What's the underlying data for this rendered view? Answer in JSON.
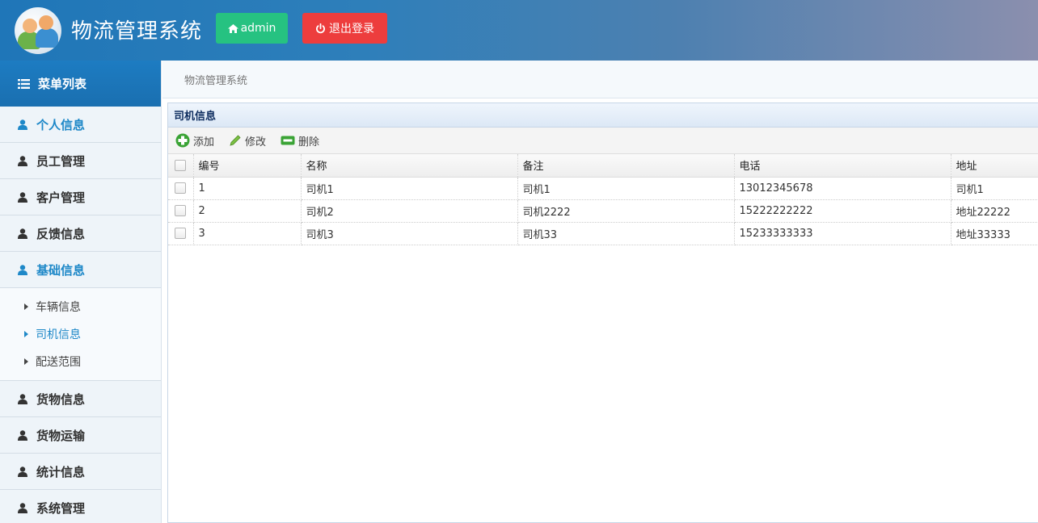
{
  "header": {
    "title": "物流管理系统",
    "user_button": "admin",
    "logout_button": "退出登录"
  },
  "sidebar": {
    "heading": "菜单列表",
    "items": [
      {
        "label": "个人信息",
        "active": true
      },
      {
        "label": "员工管理",
        "active": false
      },
      {
        "label": "客户管理",
        "active": false
      },
      {
        "label": "反馈信息",
        "active": false
      },
      {
        "label": "基础信息",
        "active": true
      },
      {
        "label": "货物信息",
        "active": false
      },
      {
        "label": "货物运输",
        "active": false
      },
      {
        "label": "统计信息",
        "active": false
      },
      {
        "label": "系统管理",
        "active": false
      }
    ],
    "subitems": [
      {
        "label": "车辆信息",
        "active": false
      },
      {
        "label": "司机信息",
        "active": true
      },
      {
        "label": "配送范围",
        "active": false
      }
    ]
  },
  "breadcrumb": "物流管理系统",
  "panel": {
    "title": "司机信息",
    "toolbar": {
      "add": "添加",
      "edit": "修改",
      "delete": "删除"
    },
    "columns": [
      "编号",
      "名称",
      "备注",
      "电话",
      "地址"
    ],
    "rows": [
      [
        "1",
        "司机1",
        "司机1",
        "13012345678",
        "司机1"
      ],
      [
        "2",
        "司机2",
        "司机2222",
        "15222222222",
        "地址22222"
      ],
      [
        "3",
        "司机3",
        "司机33",
        "15233333333",
        "地址33333"
      ]
    ]
  },
  "colors": {
    "accent": "#1e88c8",
    "success": "#26c281",
    "danger": "#ed3d3d"
  }
}
